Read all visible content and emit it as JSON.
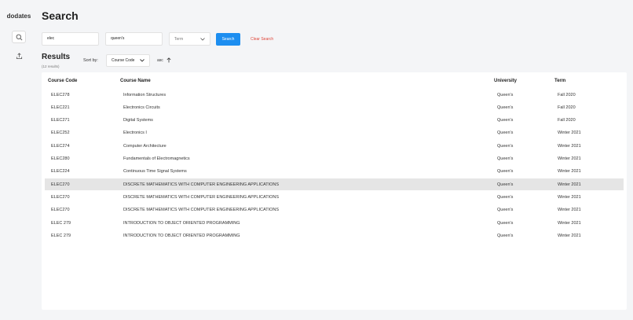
{
  "app": {
    "brand": "dodates"
  },
  "sidebar": {
    "items": [
      {
        "icon": "search-icon"
      },
      {
        "icon": "upload-icon"
      }
    ]
  },
  "page": {
    "title": "Search"
  },
  "search": {
    "subject_value": "elec",
    "school_value": "queen's",
    "term_value": "Term",
    "search_label": "Search",
    "clear_label": "Clear Search"
  },
  "results": {
    "title": "Results",
    "count": "(12 results)",
    "sort_by_label": "Sort by:",
    "sort_value": "Course Code",
    "sort_direction": "asc"
  },
  "table": {
    "headers": [
      "Course Code",
      "Course Name",
      "University",
      "Term"
    ],
    "rows": [
      [
        "ELEC278",
        "Information Structures",
        "Queen's",
        "Fall 2020"
      ],
      [
        "ELEC221",
        "Electronics Circuits",
        "Queen's",
        "Fall 2020"
      ],
      [
        "ELEC271",
        "Digital Systems",
        "Queen's",
        "Fall 2020"
      ],
      [
        "ELEC252",
        "Electronics I",
        "Queen's",
        "Winter 2021"
      ],
      [
        "ELEC274",
        "Computer Architecture",
        "Queen's",
        "Winter 2021"
      ],
      [
        "ELEC280",
        "Fundamentals of Electromagnetics",
        "Queen's",
        "Winter 2021"
      ],
      [
        "ELEC224",
        "Continuous Time Signal Systems",
        "Queen's",
        "Winter 2021"
      ],
      [
        "ELEC270",
        "DISCRETE MATHEMATICS WITH COMPUTER ENGINEERING APPLICATIONS",
        "Queen's",
        "Winter 2021"
      ],
      [
        "ELEC270",
        "DISCRETE MATHEMATICS WITH COMPUTER ENGINEERING APPLICATIONS",
        "Queen's",
        "Winter 2021"
      ],
      [
        "ELEC270",
        "DISCRETE MATHEMATICS WITH COMPUTER ENGINEERING APPLICATIONS",
        "Queen's",
        "Winter 2021"
      ],
      [
        "ELEC 279",
        "INTRODUCTION TO OBJECT ORIENTED PROGRAMMING",
        "Queen's",
        "Winter 2021"
      ],
      [
        "ELEC 279",
        "INTRODUCTION TO OBJECT ORIENTED PROGRAMMING",
        "Queen's",
        "Winter 2021"
      ]
    ]
  }
}
